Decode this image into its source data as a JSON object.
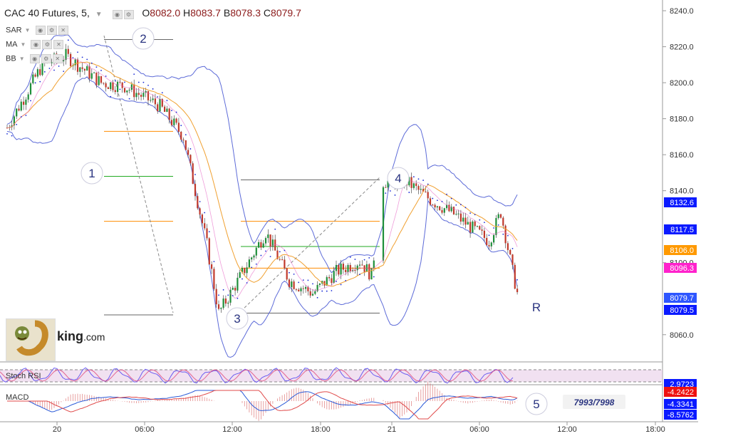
{
  "header": {
    "symbol": "CAC 40 Futures, 5,",
    "open_label": "O",
    "open": "8082.0",
    "high_label": "H",
    "high": "8083.7",
    "low_label": "B",
    "low": "8078.3",
    "close_label": "C",
    "close": "8079.7"
  },
  "indicators": [
    {
      "label": "SAR"
    },
    {
      "label": "MA"
    },
    {
      "label": "BB"
    }
  ],
  "logo": {
    "text_bold": "king",
    "text_rest": ".com"
  },
  "annotations": {
    "n1": "1",
    "n2": "2",
    "n3": "3",
    "n4": "4",
    "n5": "5",
    "r": "R",
    "targets": "7993/7998"
  },
  "sub_panels": {
    "stoch_label": "Stoch RSI",
    "macd_label": "MACD"
  },
  "price_tags": [
    {
      "value": "8132.6",
      "color": "#0a1aff"
    },
    {
      "value": "8117.5",
      "color": "#0a1aff"
    },
    {
      "value": "8106.0",
      "color": "#ff9900"
    },
    {
      "value": "8096.3",
      "color": "#ff22cc"
    },
    {
      "value": "8079.7",
      "color": "#2e56ff"
    },
    {
      "value": "8079.5",
      "color": "#0a1aff"
    },
    {
      "value": "2.9723",
      "color": "#0a1aff"
    },
    {
      "value": "-4.2422",
      "color": "#ee1111"
    },
    {
      "value": "-4.3341",
      "color": "#0a1aff"
    },
    {
      "value": "-8.5762",
      "color": "#0a1aff"
    }
  ],
  "chart_data": {
    "type": "candlestick",
    "y_axis_ticks": [
      "8240.0",
      "8220.0",
      "8200.0",
      "8180.0",
      "8160.0",
      "8140.0",
      "8100.0",
      "8060.0"
    ],
    "ylim": [
      8052,
      8242
    ],
    "x_axis_ticks": [
      "20",
      "06:00",
      "12:00",
      "18:00",
      "21",
      "06:00",
      "12:00",
      "18:00"
    ],
    "close_path": [
      {
        "t": 0,
        "close": 8175
      },
      {
        "t": 3,
        "close": 8210
      },
      {
        "t": 5,
        "close": 8215
      },
      {
        "t": 8,
        "close": 8200
      },
      {
        "t": 10,
        "close": 8198
      },
      {
        "t": 13,
        "close": 8187
      },
      {
        "t": 15,
        "close": 8170
      },
      {
        "t": 17,
        "close": 8110
      },
      {
        "t": 18,
        "close": 8072
      },
      {
        "t": 20,
        "close": 8094
      },
      {
        "t": 22,
        "close": 8117
      },
      {
        "t": 24,
        "close": 8090
      },
      {
        "t": 26,
        "close": 8083
      },
      {
        "t": 28,
        "close": 8095
      },
      {
        "t": 30,
        "close": 8101
      },
      {
        "t": 31,
        "close": 8093
      },
      {
        "t": 32,
        "close": 8145
      },
      {
        "t": 34,
        "close": 8145
      },
      {
        "t": 36,
        "close": 8135
      },
      {
        "t": 38,
        "close": 8127
      },
      {
        "t": 40,
        "close": 8117
      },
      {
        "t": 41,
        "close": 8112
      },
      {
        "t": 42,
        "close": 8128
      },
      {
        "t": 43,
        "close": 8095
      },
      {
        "t": 43.5,
        "close": 8080
      }
    ],
    "horizontal_levels": [
      {
        "name": "ext-top",
        "value": 8224,
        "color": "#666666"
      },
      {
        "name": "fib-orange-1",
        "value": 8173,
        "color": "#ff8c00"
      },
      {
        "name": "fib-green-1",
        "value": 8148,
        "color": "#22aa22"
      },
      {
        "name": "fib-orange-2",
        "value": 8123,
        "color": "#ff8c00"
      },
      {
        "name": "ext-bottom",
        "value": 8071,
        "color": "#666666"
      },
      {
        "name": "range-top",
        "value": 8146,
        "color": "#666666"
      },
      {
        "name": "range-orange-1",
        "value": 8123,
        "color": "#ff8c00"
      },
      {
        "name": "range-green",
        "value": 8109,
        "color": "#22aa22"
      },
      {
        "name": "range-orange-2",
        "value": 8097,
        "color": "#ff8c00"
      },
      {
        "name": "range-bottom",
        "value": 8072,
        "color": "#666666"
      }
    ]
  }
}
